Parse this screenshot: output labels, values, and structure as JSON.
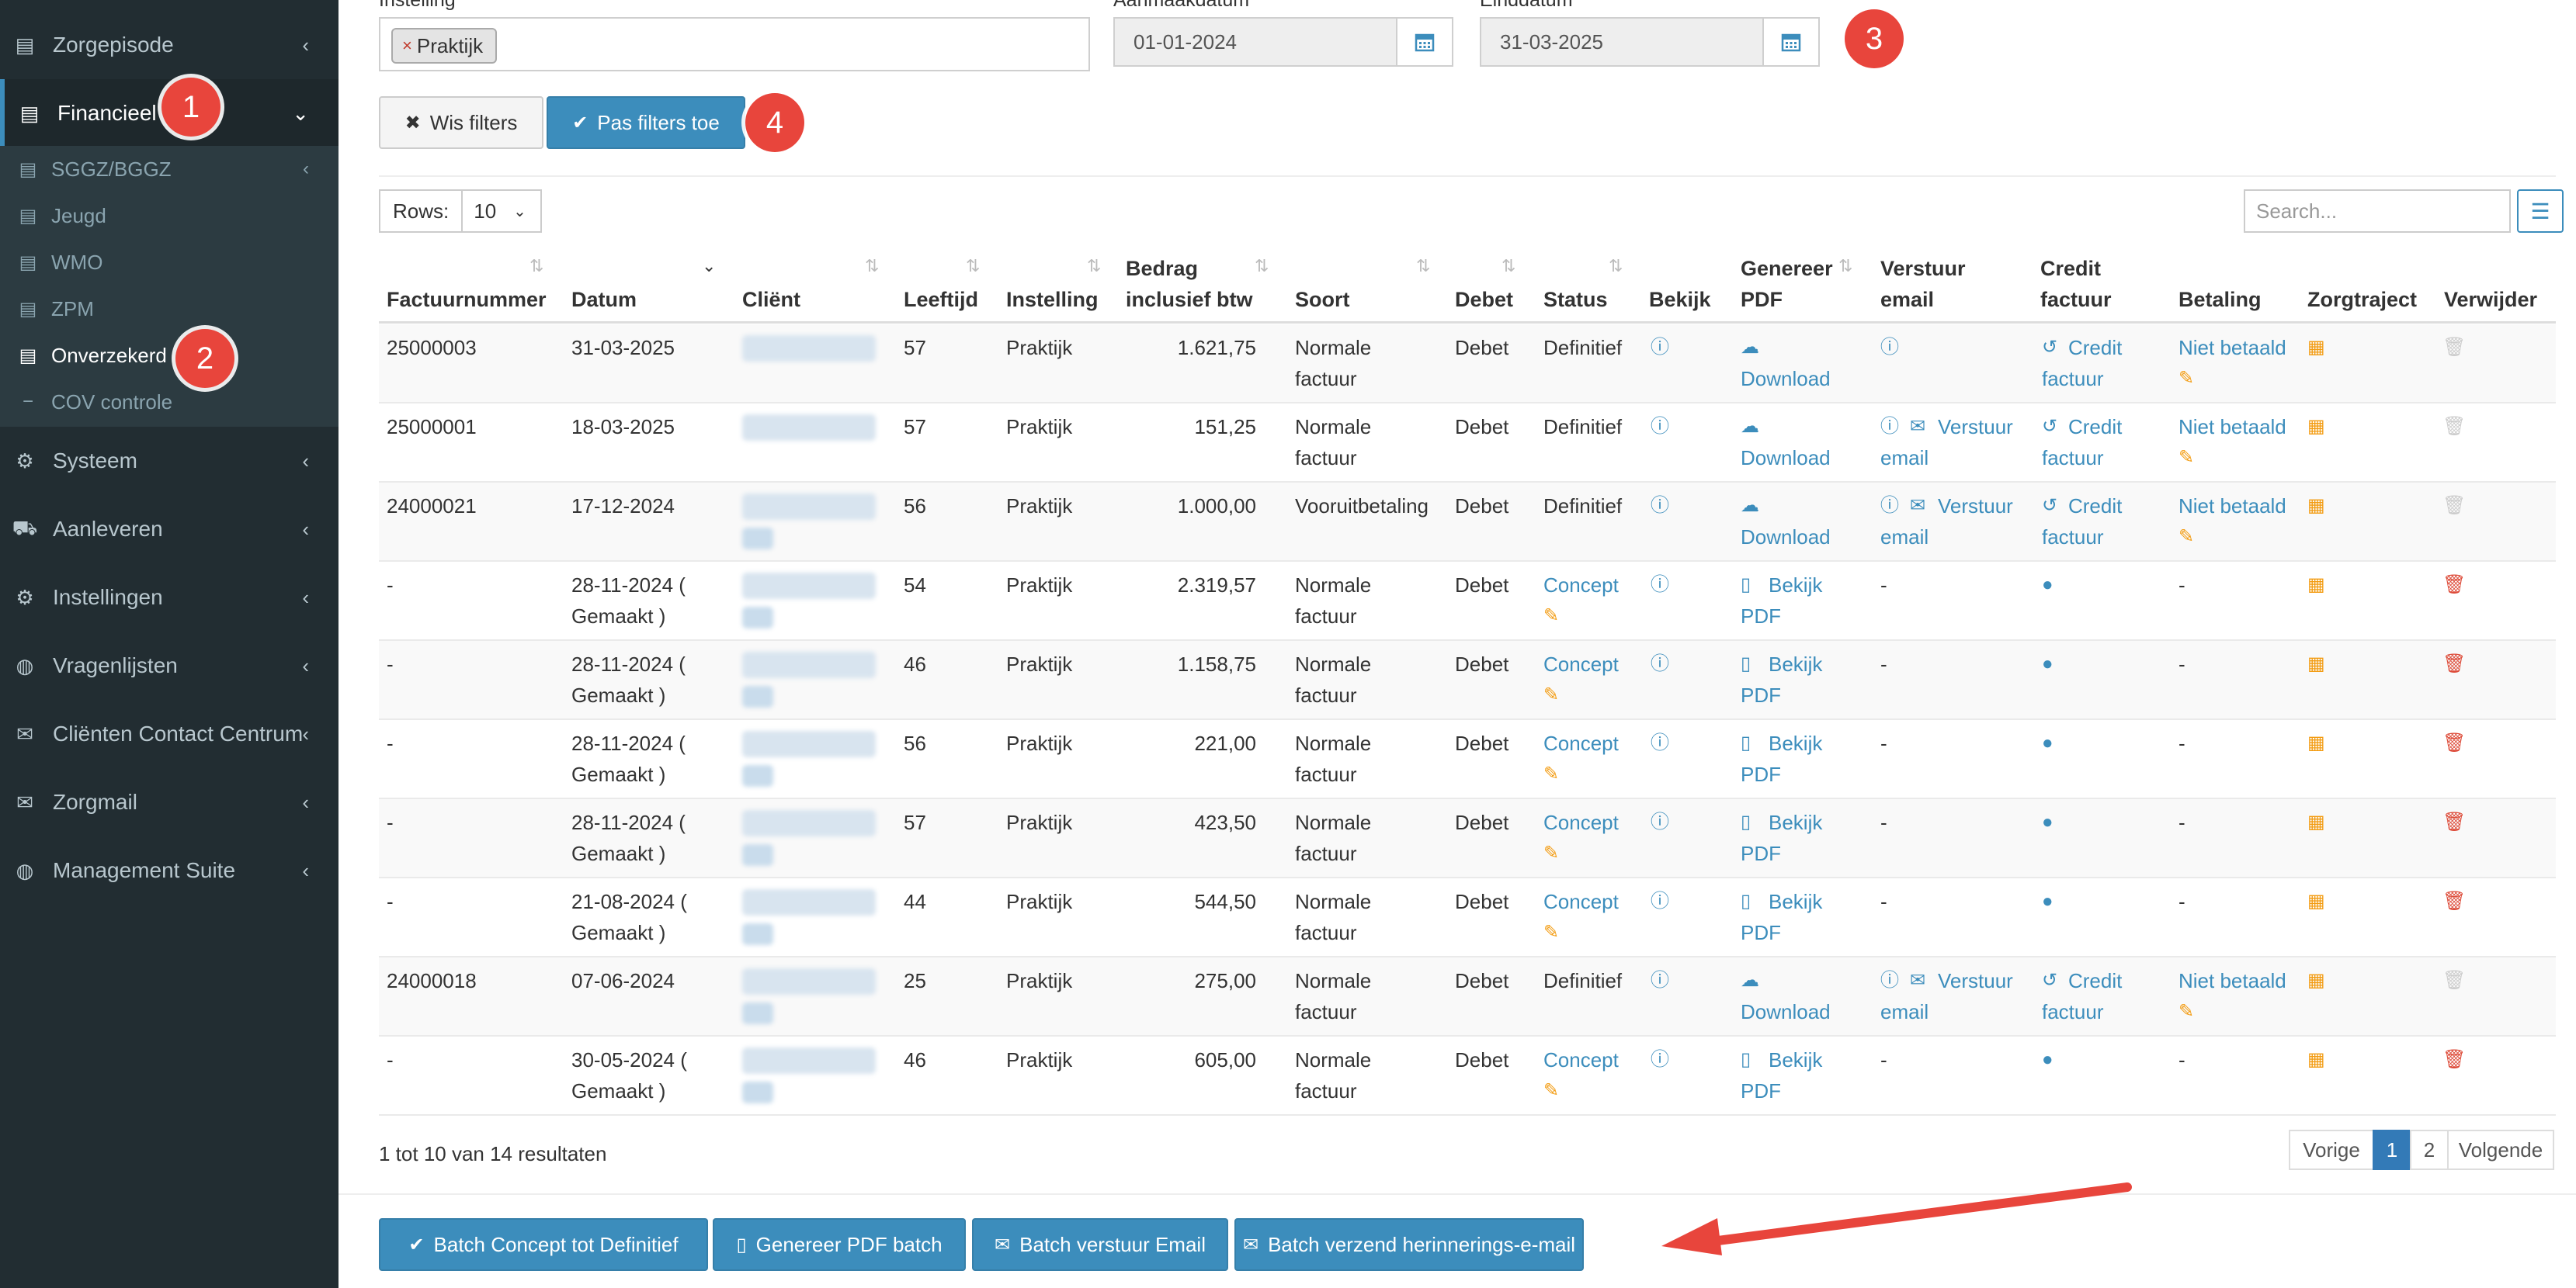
{
  "sidebar": {
    "items": [
      {
        "icon": "book-icon",
        "label": "Zorgepisode"
      },
      {
        "icon": "book-icon",
        "label": "Financieel"
      },
      {
        "icon": "cogs-icon",
        "label": "Systeem"
      },
      {
        "icon": "truck-icon",
        "label": "Aanleveren"
      },
      {
        "icon": "gear-icon",
        "label": "Instellingen"
      },
      {
        "icon": "globe-icon",
        "label": "Vragenlijsten"
      },
      {
        "icon": "envelope-icon",
        "label": "Cliënten Contact Centrum"
      },
      {
        "icon": "envelope-icon",
        "label": "Zorgmail"
      },
      {
        "icon": "globe-icon",
        "label": "Management Suite"
      }
    ],
    "financieel_sub": [
      {
        "label": "SGGZ/BGGZ"
      },
      {
        "label": "Jeugd"
      },
      {
        "label": "WMO"
      },
      {
        "label": "ZPM"
      },
      {
        "label": "Onverzekerd"
      },
      {
        "label": "COV controle"
      }
    ]
  },
  "markers": [
    "1",
    "2",
    "3",
    "4"
  ],
  "filters": {
    "instelling_label": "Instelling",
    "instelling_tag": "Praktijk",
    "tag_remove": "×",
    "aanmaak_label": "Aanmaakdatum",
    "aanmaak_value": "01-01-2024",
    "eind_label": "Einddatum",
    "eind_value": "31-03-2025",
    "clear_label": "Wis filters",
    "apply_label": "Pas filters toe"
  },
  "table_controls": {
    "rows_label": "Rows:",
    "rows_value": "10",
    "search_placeholder": "Search..."
  },
  "table": {
    "headers": {
      "factuurnummer": "Factuurnummer",
      "datum": "Datum",
      "client": "Cliënt",
      "leeftijd": "Leeftijd",
      "instelling": "Instelling",
      "bedrag_1": "Bedrag",
      "bedrag_2": "inclusief btw",
      "soort": "Soort",
      "debet": "Debet",
      "status": "Status",
      "bekijk": "Bekijk",
      "genereer_1": "Genereer",
      "genereer_2": "PDF",
      "verstuur_1": "Verstuur",
      "verstuur_2": "email",
      "credit_1": "Credit",
      "credit_2": "factuur",
      "betaling": "Betaling",
      "zorgtraject": "Zorgtraject",
      "verwijder": "Verwijder"
    },
    "rows": [
      {
        "factuur": "25000003",
        "datum_1": "31-03-2025",
        "datum_2": "",
        "leeftijd": "57",
        "instelling": "Praktijk",
        "bedrag": "1.621,75",
        "soort_1": "Normale",
        "soort_2": "factuur",
        "debet": "Debet",
        "status": "Definitief",
        "pdf_1": "Download",
        "pdf_2": "",
        "verstuur_1": "",
        "verstuur_2": "",
        "credit_1": "Credit",
        "credit_2": "factuur",
        "betaling": "Niet betaald",
        "concept": false,
        "has_verstuur": false
      },
      {
        "factuur": "25000001",
        "datum_1": "18-03-2025",
        "datum_2": "",
        "leeftijd": "57",
        "instelling": "Praktijk",
        "bedrag": "151,25",
        "soort_1": "Normale",
        "soort_2": "factuur",
        "debet": "Debet",
        "status": "Definitief",
        "pdf_1": "Download",
        "pdf_2": "",
        "verstuur_1": "Verstuur",
        "verstuur_2": "email",
        "credit_1": "Credit",
        "credit_2": "factuur",
        "betaling": "Niet betaald",
        "concept": false,
        "has_verstuur": true
      },
      {
        "factuur": "24000021",
        "datum_1": "17-12-2024",
        "datum_2": "",
        "leeftijd": "56",
        "instelling": "Praktijk",
        "bedrag": "1.000,00",
        "soort_1": "Vooruitbetaling",
        "soort_2": "",
        "debet": "Debet",
        "status": "Definitief",
        "pdf_1": "Download",
        "pdf_2": "",
        "verstuur_1": "Verstuur",
        "verstuur_2": "email",
        "credit_1": "Credit",
        "credit_2": "factuur",
        "betaling": "Niet betaald",
        "concept": false,
        "has_verstuur": true
      },
      {
        "factuur": "-",
        "datum_1": "28-11-2024 (",
        "datum_2": "Gemaakt )",
        "leeftijd": "54",
        "instelling": "Praktijk",
        "bedrag": "2.319,57",
        "soort_1": "Normale",
        "soort_2": "factuur",
        "debet": "Debet",
        "status": "Concept",
        "pdf_1": "Bekijk",
        "pdf_2": "PDF",
        "verstuur_1": "-",
        "verstuur_2": "",
        "credit_1": "",
        "credit_2": "",
        "betaling": "-",
        "concept": true,
        "has_verstuur": false
      },
      {
        "factuur": "-",
        "datum_1": "28-11-2024 (",
        "datum_2": "Gemaakt )",
        "leeftijd": "46",
        "instelling": "Praktijk",
        "bedrag": "1.158,75",
        "soort_1": "Normale",
        "soort_2": "factuur",
        "debet": "Debet",
        "status": "Concept",
        "pdf_1": "Bekijk",
        "pdf_2": "PDF",
        "verstuur_1": "-",
        "verstuur_2": "",
        "credit_1": "",
        "credit_2": "",
        "betaling": "-",
        "concept": true,
        "has_verstuur": false
      },
      {
        "factuur": "-",
        "datum_1": "28-11-2024 (",
        "datum_2": "Gemaakt )",
        "leeftijd": "56",
        "instelling": "Praktijk",
        "bedrag": "221,00",
        "soort_1": "Normale",
        "soort_2": "factuur",
        "debet": "Debet",
        "status": "Concept",
        "pdf_1": "Bekijk",
        "pdf_2": "PDF",
        "verstuur_1": "-",
        "verstuur_2": "",
        "credit_1": "",
        "credit_2": "",
        "betaling": "-",
        "concept": true,
        "has_verstuur": false
      },
      {
        "factuur": "-",
        "datum_1": "28-11-2024 (",
        "datum_2": "Gemaakt )",
        "leeftijd": "57",
        "instelling": "Praktijk",
        "bedrag": "423,50",
        "soort_1": "Normale",
        "soort_2": "factuur",
        "debet": "Debet",
        "status": "Concept",
        "pdf_1": "Bekijk",
        "pdf_2": "PDF",
        "verstuur_1": "-",
        "verstuur_2": "",
        "credit_1": "",
        "credit_2": "",
        "betaling": "-",
        "concept": true,
        "has_verstuur": false
      },
      {
        "factuur": "-",
        "datum_1": "21-08-2024 (",
        "datum_2": "Gemaakt )",
        "leeftijd": "44",
        "instelling": "Praktijk",
        "bedrag": "544,50",
        "soort_1": "Normale",
        "soort_2": "factuur",
        "debet": "Debet",
        "status": "Concept",
        "pdf_1": "Bekijk",
        "pdf_2": "PDF",
        "verstuur_1": "-",
        "verstuur_2": "",
        "credit_1": "",
        "credit_2": "",
        "betaling": "-",
        "concept": true,
        "has_verstuur": false
      },
      {
        "factuur": "24000018",
        "datum_1": "07-06-2024",
        "datum_2": "",
        "leeftijd": "25",
        "instelling": "Praktijk",
        "bedrag": "275,00",
        "soort_1": "Normale",
        "soort_2": "factuur",
        "debet": "Debet",
        "status": "Definitief",
        "pdf_1": "Download",
        "pdf_2": "",
        "verstuur_1": "Verstuur",
        "verstuur_2": "email",
        "credit_1": "Credit",
        "credit_2": "factuur",
        "betaling": "Niet betaald",
        "concept": false,
        "has_verstuur": true
      },
      {
        "factuur": "-",
        "datum_1": "30-05-2024 (",
        "datum_2": "Gemaakt )",
        "leeftijd": "46",
        "instelling": "Praktijk",
        "bedrag": "605,00",
        "soort_1": "Normale",
        "soort_2": "factuur",
        "debet": "Debet",
        "status": "Concept",
        "pdf_1": "Bekijk",
        "pdf_2": "PDF",
        "verstuur_1": "-",
        "verstuur_2": "",
        "credit_1": "",
        "credit_2": "",
        "betaling": "-",
        "concept": true,
        "has_verstuur": false
      }
    ]
  },
  "pagination": {
    "info": "1 tot 10 van 14 resultaten",
    "prev": "Vorige",
    "pages": [
      "1",
      "2"
    ],
    "next": "Volgende"
  },
  "batch": {
    "concept_definitief": "Batch Concept tot Definitief",
    "genereer_pdf": "Genereer PDF batch",
    "verstuur_email": "Batch verstuur Email",
    "herinnering": "Batch verzend herinnerings-e-mail"
  },
  "colors": {
    "accent": "#3c8dbc",
    "sidebar": "#222d32",
    "marker": "#e8453c",
    "warning": "#f39c12",
    "danger": "#dd4b39"
  }
}
